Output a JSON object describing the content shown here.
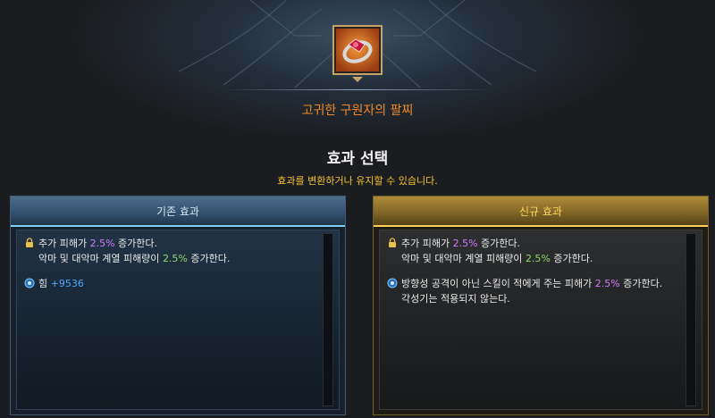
{
  "item": {
    "name": "고귀한 구원자의 팔찌",
    "icon": "bracelet-icon"
  },
  "section": {
    "title": "효과 선택",
    "subtitle": "효과를 변환하거나 유지할 수 있습니다."
  },
  "existing": {
    "header": "기존 효과",
    "effects": [
      {
        "icon": "lock-icon",
        "line1": {
          "pre": "추가 피해가 ",
          "value": "2.5%",
          "post": " 증가한다."
        },
        "line2": {
          "pre": "악마 및 대악마 계열 피해량이 ",
          "value": "2.5%",
          "post": " 증가한다."
        }
      },
      {
        "icon": "stat-icon",
        "label": "힘 ",
        "value": "+9536"
      }
    ]
  },
  "new": {
    "header": "신규 효과",
    "effects": [
      {
        "icon": "lock-icon",
        "line1": {
          "pre": "추가 피해가 ",
          "value": "2.5%",
          "post": " 증가한다."
        },
        "line2": {
          "pre": "악마 및 대악마 계열 피해량이 ",
          "value": "2.5%",
          "post": " 증가한다."
        }
      },
      {
        "icon": "stat-icon",
        "line1": {
          "pre": "방향성 공격이 아닌 스킬이 적에게 주는 피해가 ",
          "value": "2.5%",
          "post": " 증가한다."
        },
        "line2": "각성기는 적용되지 않는다."
      }
    ]
  },
  "colors": {
    "item_name": "#f0882a",
    "subtitle": "#f2c531",
    "value_pink": "#d27bff",
    "value_green": "#8ed96b",
    "stat_blue": "#4fa9ff"
  }
}
